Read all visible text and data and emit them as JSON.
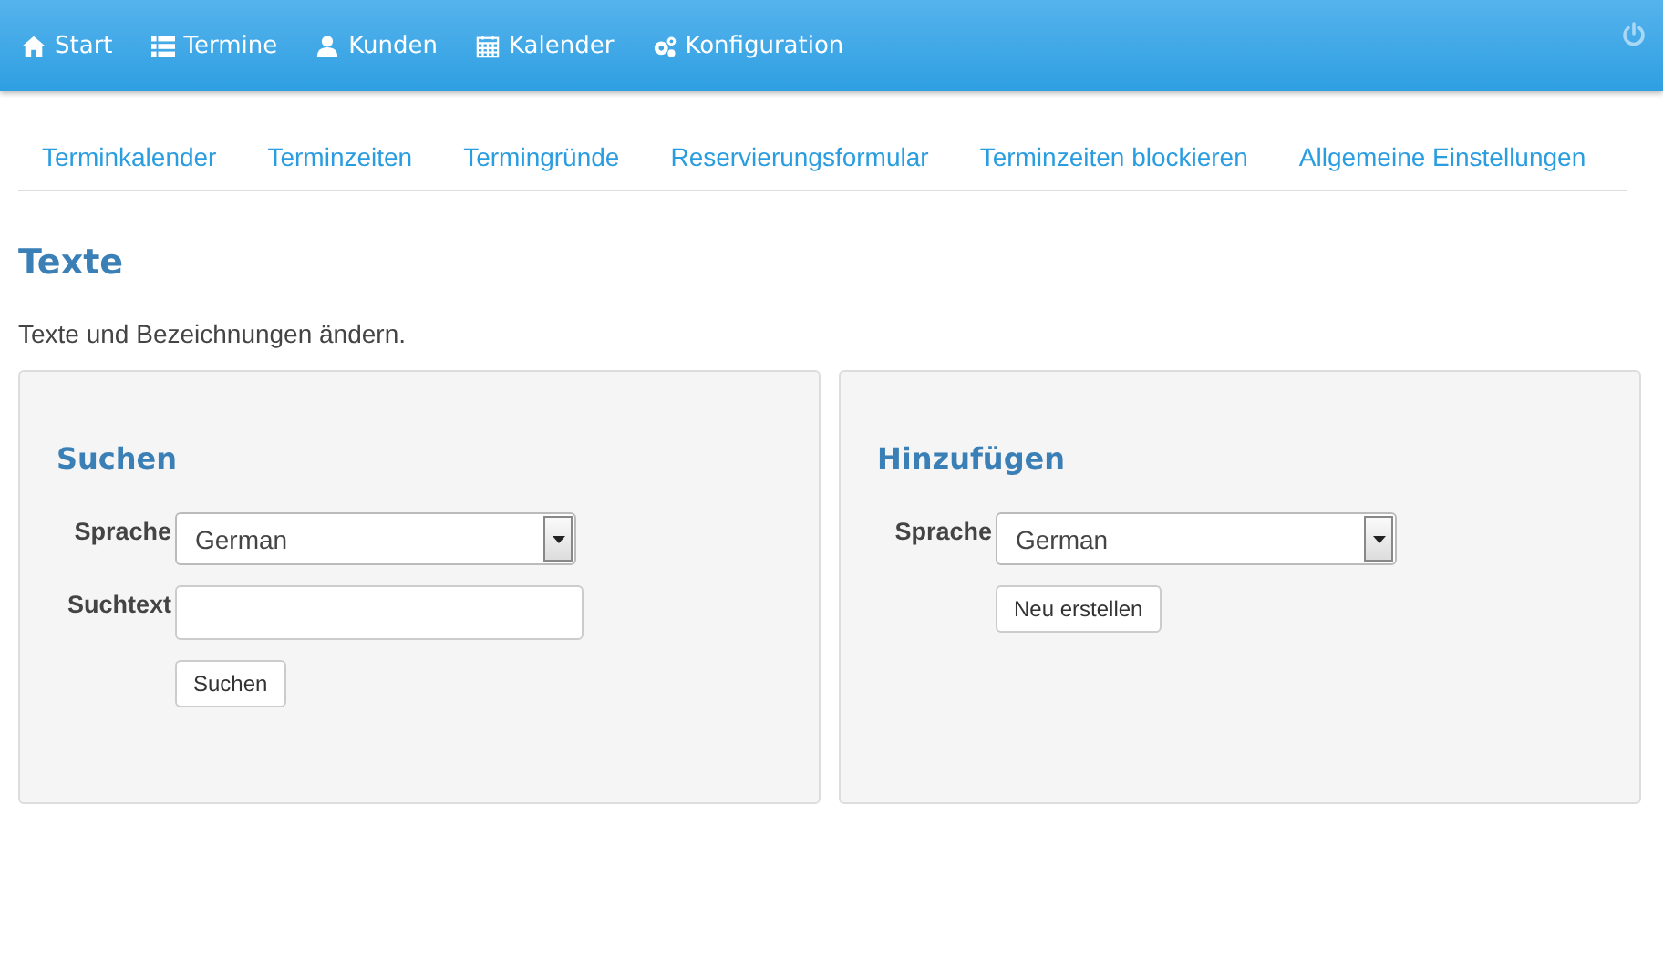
{
  "navbar": {
    "items": [
      {
        "label": "Start"
      },
      {
        "label": "Termine"
      },
      {
        "label": "Kunden"
      },
      {
        "label": "Kalender"
      },
      {
        "label": "Konfiguration"
      }
    ]
  },
  "tabs": [
    {
      "label": "Terminkalender"
    },
    {
      "label": "Terminzeiten"
    },
    {
      "label": "Termingründe"
    },
    {
      "label": "Reservierungsformular"
    },
    {
      "label": "Terminzeiten blockieren"
    },
    {
      "label": "Allgemeine Einstellungen"
    }
  ],
  "page": {
    "title": "Texte",
    "description": "Texte und Bezeichnungen ändern."
  },
  "panels": [
    {
      "title": "Suchen",
      "fields": [
        {
          "kind": "select",
          "label": "Sprache",
          "value": "German"
        },
        {
          "kind": "text",
          "label": "Suchtext"
        },
        {
          "kind": "button",
          "label": "Suchen"
        }
      ]
    },
    {
      "title": "Hinzufügen",
      "fields": [
        {
          "kind": "select",
          "label": "Sprache",
          "value": "German"
        },
        {
          "kind": "button",
          "label": "Neu erstellen"
        }
      ]
    }
  ]
}
